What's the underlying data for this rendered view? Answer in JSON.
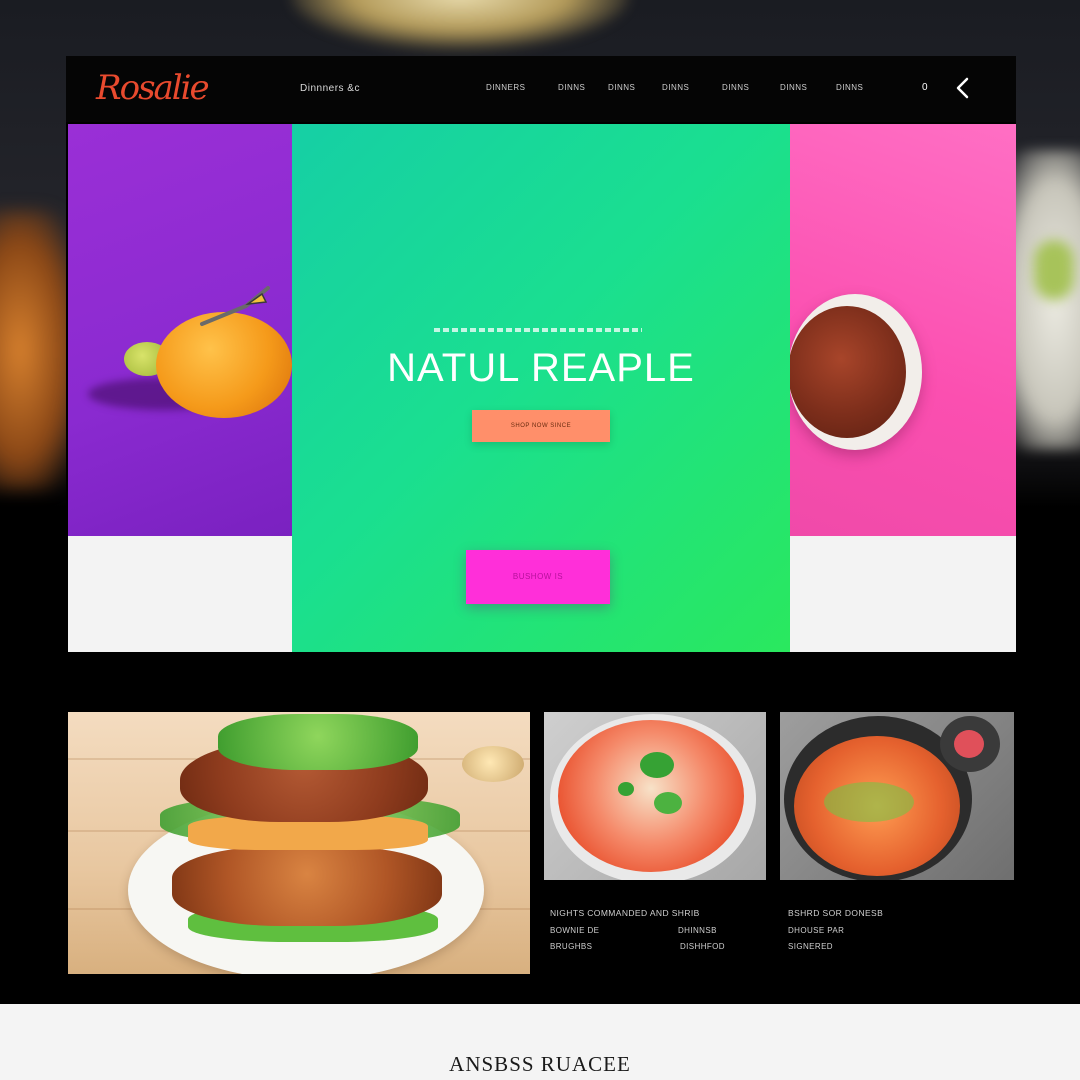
{
  "header": {
    "logo_text": "Rosalie",
    "brand_sub": "Dinnners &c",
    "nav": [
      "DINNERS",
      "DINNS",
      "DINNS",
      "DINNS",
      "DINNS",
      "DINNS",
      "DINNS"
    ],
    "counter": "0"
  },
  "hero": {
    "title": "NATUL REAPLE",
    "primary_button": "SHOP NOW SINCE",
    "secondary_button": "BUSHOW IS"
  },
  "gallery": {
    "bowl_caption": {
      "line1": "NIGHTS COMMANDED AND SHRIB",
      "line2a": "BOWNIE DE",
      "line2b": "DHINNSB",
      "line3a": "BRUGHBS",
      "line3b": "DISHHFOD"
    },
    "pan_caption": {
      "line1": "BSHRD SOR DONESB",
      "line2": "DHOUSE PAR",
      "line3": "SIGNERED"
    }
  },
  "footer": {
    "title": "ANSBSS RUACEE"
  },
  "colors": {
    "accent_orange": "#ff8f6a",
    "accent_magenta": "#ff2fd9",
    "hero_green": "#1adf90",
    "panel_purple": "#8a2ad0",
    "panel_pink": "#fb4fb0",
    "logo_red": "#e84a2e"
  }
}
